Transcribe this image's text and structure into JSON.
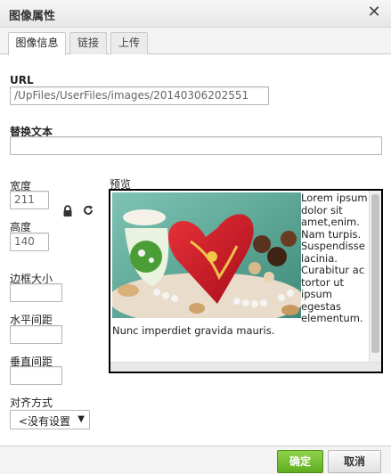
{
  "dialog": {
    "title": "图像属性",
    "close_glyph": "✕"
  },
  "tabs": [
    {
      "label": "图像信息",
      "active": true
    },
    {
      "label": "链接",
      "active": false
    },
    {
      "label": "上传",
      "active": false
    }
  ],
  "form": {
    "url_label": "URL",
    "url_value": "/UpFiles/UserFiles/images/20140306202551",
    "alt_label": "替换文本",
    "alt_value": "",
    "width_label": "宽度",
    "width_value": "211",
    "height_label": "高度",
    "height_value": "140",
    "lock_icon": "lock-icon",
    "reset_icon": "reset-size-icon",
    "border_label": "边框大小",
    "border_value": "",
    "hspace_label": "水平间距",
    "hspace_value": "",
    "vspace_label": "垂直间距",
    "vspace_value": "",
    "align_label": "对齐方式",
    "align_value": "<没有设置",
    "align_arrow": "▼"
  },
  "preview": {
    "label": "预览",
    "text": "Lorem ipsum dolor sit amet,enim. Nam turpis. Suspendisse lacinia. Curabitur ac tortor ut ipsum egestas elementum. Nunc imperdiet gravida mauris."
  },
  "buttons": {
    "ok_label": "确定",
    "cancel_label": "取消",
    "ok_color": "#6bbd2a"
  }
}
